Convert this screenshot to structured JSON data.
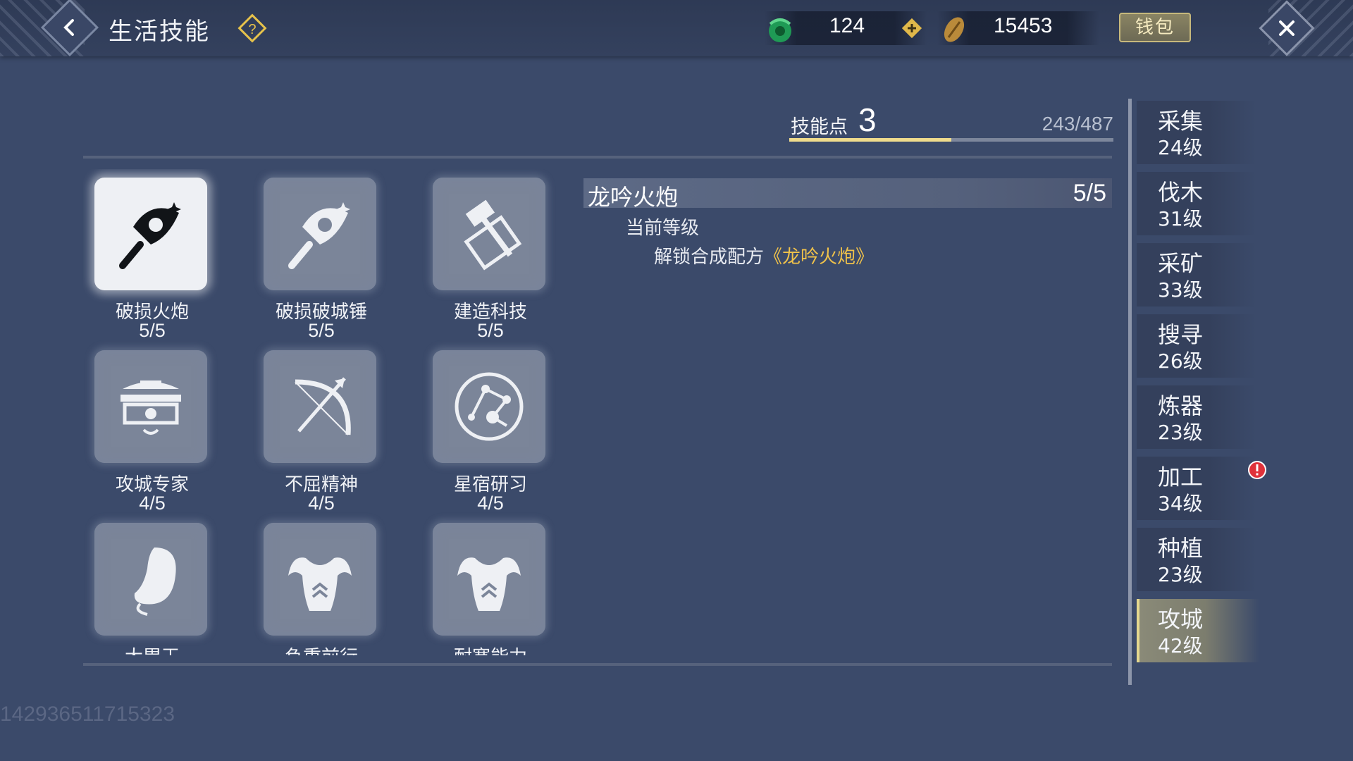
{
  "header": {
    "title": "生活技能",
    "jade_value": "124",
    "coin_value": "15453",
    "wallet_label": "钱包"
  },
  "skill_points": {
    "label": "技能点",
    "value": "3",
    "progress_text": "243/487",
    "progress_fraction": 0.499
  },
  "skills": [
    {
      "name": "破损火炮",
      "level": "5/5",
      "icon": "axe-icon",
      "active": true
    },
    {
      "name": "破损破城锤",
      "level": "5/5",
      "icon": "axe-icon",
      "active": false
    },
    {
      "name": "建造科技",
      "level": "5/5",
      "icon": "hammer-blueprint-icon",
      "active": false
    },
    {
      "name": "攻城专家",
      "level": "4/5",
      "icon": "pavilion-icon",
      "active": false
    },
    {
      "name": "不屈精神",
      "level": "4/5",
      "icon": "bow-arrow-icon",
      "active": false
    },
    {
      "name": "星宿研习",
      "level": "4/5",
      "icon": "constellation-icon",
      "active": false
    },
    {
      "name": "大胃王",
      "level": "",
      "icon": "stomach-icon",
      "active": false
    },
    {
      "name": "负重前行",
      "level": "",
      "icon": "muscle-icon",
      "active": false
    },
    {
      "name": "耐寒能力",
      "level": "",
      "icon": "muscle-icon",
      "active": false
    }
  ],
  "detail": {
    "title": "龙吟火炮",
    "level": "5/5",
    "current_label": "当前等级",
    "unlock_prefix": "解锁合成配方",
    "unlock_item": "《龙吟火炮》"
  },
  "categories": [
    {
      "name": "采集",
      "level": "24级"
    },
    {
      "name": "伐木",
      "level": "31级"
    },
    {
      "name": "采矿",
      "level": "33级"
    },
    {
      "name": "搜寻",
      "level": "26级"
    },
    {
      "name": "炼器",
      "level": "23级"
    },
    {
      "name": "加工",
      "level": "34级"
    },
    {
      "name": "种植",
      "level": "23级"
    },
    {
      "name": "攻城",
      "level": "42级"
    }
  ],
  "selected_category": "攻城",
  "alert_category": "加工",
  "watermark": "142936511715323",
  "colors": {
    "background": "#3b4a6a",
    "highlight": "#f0c24a",
    "progress": "#f0dc8c",
    "alert": "#e0323a"
  }
}
